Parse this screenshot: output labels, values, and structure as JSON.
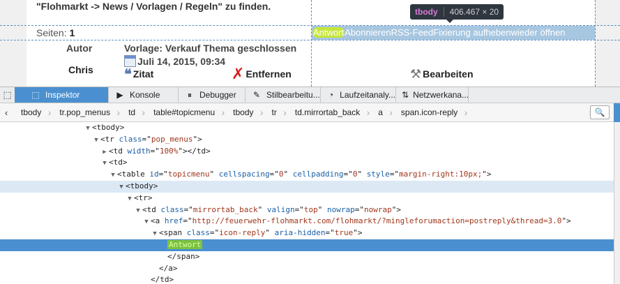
{
  "page": {
    "intro_text": "\"Flohmarkt -> News / Vorlagen / Regeln\" zu finden.",
    "pages_label": "Seiten:",
    "pages_value": "1",
    "menu_links": [
      "Antwort",
      "Abonnieren",
      "RSS-Feed",
      "Fixierung aufheben",
      "wieder öffnen"
    ],
    "tooltip": {
      "tag": "tbody",
      "dimensions": "406.467 × 20"
    },
    "author_label": "Autor",
    "author_name": "Chris",
    "post_title": "Vorlage: Verkauf Thema geschlossen",
    "post_date": "Juli 14, 2015, 09:34",
    "actions": {
      "quote": "Zitat",
      "remove": "Entfernen",
      "edit": "Bearbeiten"
    }
  },
  "devtools": {
    "tabs": [
      {
        "label": "Inspektor",
        "icon": "inspector-icon",
        "glyph": "⬚"
      },
      {
        "label": "Konsole",
        "icon": "console-icon",
        "glyph": "▶"
      },
      {
        "label": "Debugger",
        "icon": "debugger-icon",
        "glyph": "⏸"
      },
      {
        "label": "Stilbearbeitu...",
        "icon": "style-editor-icon",
        "glyph": "✎"
      },
      {
        "label": "Laufzeitanaly...",
        "icon": "performance-icon",
        "glyph": "◔"
      },
      {
        "label": "Netzwerkana...",
        "icon": "network-icon",
        "glyph": "⇅"
      }
    ],
    "breadcrumbs": [
      "tbody",
      "tr.pop_menus",
      "td",
      "table#topicmenu",
      "tbody",
      "tr",
      "td.mirrortab_back",
      "a",
      "span.icon-reply"
    ],
    "selected_text": "Antwort",
    "tree": [
      {
        "indent": 10,
        "twisty": "▼",
        "html": "&lt;tbody&gt;"
      },
      {
        "indent": 11,
        "twisty": "▼",
        "html": "&lt;tr <span class='an'>class</span>=\"<span class='av'>pop_menus</span>\"&gt;"
      },
      {
        "indent": 12,
        "twisty": "▶",
        "html": "&lt;td <span class='an'>width</span>=\"<span class='av'>100%</span>\"&gt;&lt;/td&gt;"
      },
      {
        "indent": 12,
        "twisty": "▼",
        "html": "&lt;td&gt;"
      },
      {
        "indent": 13,
        "twisty": "▼",
        "html": "&lt;table <span class='an'>id</span>=\"<span class='av'>topicmenu</span>\" <span class='an'>cellspacing</span>=\"<span class='av'>0</span>\" <span class='an'>cellpadding</span>=\"<span class='av'>0</span>\" <span class='an'>style</span>=\"<span class='av'>margin-right:10px;</span>\"&gt;"
      },
      {
        "indent": 14,
        "twisty": "▼",
        "html": "&lt;tbody&gt;",
        "state": "light"
      },
      {
        "indent": 15,
        "twisty": "▼",
        "html": "&lt;tr&gt;"
      },
      {
        "indent": 16,
        "twisty": "▼",
        "html": "&lt;td <span class='an'>class</span>=\"<span class='av'>mirrortab_back</span>\" <span class='an'>valign</span>=\"<span class='av'>top</span>\" <span class='an'>nowrap</span>=\"<span class='av'>nowrap</span>\"&gt;"
      },
      {
        "indent": 17,
        "twisty": "▼",
        "html": "&lt;a <span class='an'>href</span>=\"<span class='av'>http://feuerwehr-flohmarkt.com/flohmarkt/?mingleforumaction=postreply&amp;thread=3.0</span>\"&gt;"
      },
      {
        "indent": 18,
        "twisty": "▼",
        "html": "&lt;span <span class='an'>class</span>=\"<span class='av'>icon-reply</span>\" <span class='an'>aria-hidden</span>=\"<span class='av'>true</span>\"&gt;"
      },
      {
        "indent": 19,
        "twisty": "",
        "html": "<span class='hl-text'>Antwort</span>",
        "state": "dark"
      },
      {
        "indent": 19,
        "twisty": "",
        "html": "&lt;/span&gt;"
      },
      {
        "indent": 18,
        "twisty": "",
        "html": "&lt;/a&gt;"
      },
      {
        "indent": 17,
        "twisty": "",
        "html": "&lt;/td&gt;"
      }
    ]
  }
}
